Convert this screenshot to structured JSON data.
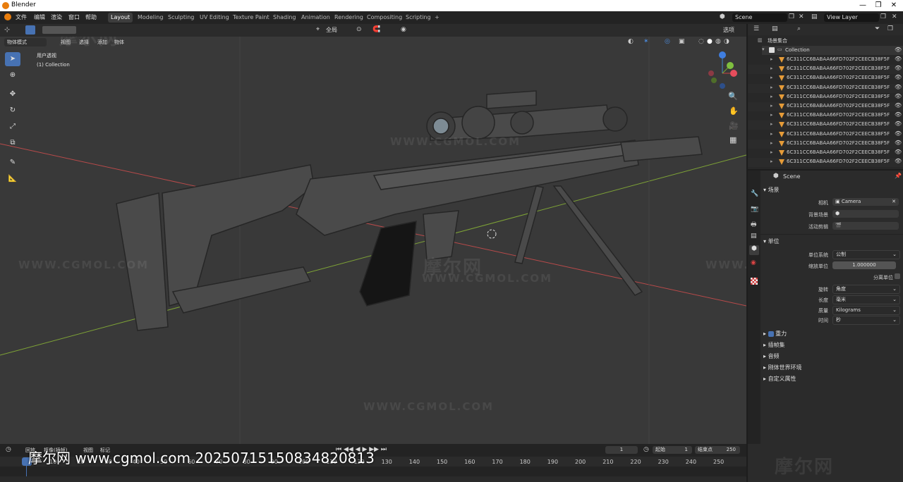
{
  "window": {
    "title": "Blender",
    "controls": [
      "—",
      "❐",
      "✕"
    ]
  },
  "menubar": {
    "items": [
      "文件",
      "编辑",
      "渲染",
      "窗口",
      "帮助"
    ]
  },
  "workspaces": {
    "tabs": [
      "Layout",
      "Modeling",
      "Sculpting",
      "UV Editing",
      "Texture Paint",
      "Shading",
      "Animation",
      "Rendering",
      "Compositing",
      "Scripting"
    ],
    "active": "Layout",
    "add": "+"
  },
  "scene": {
    "name": "Scene",
    "view_layer": "View Layer"
  },
  "viewport": {
    "mode": "物体模式",
    "menus": [
      "视图",
      "选择",
      "添加",
      "物体"
    ],
    "view_label": "用户透视",
    "collection_label": "(1) Collection",
    "transform_orientation": "全局",
    "options_label": "选项",
    "watermarks": [
      "WWW.CGMOL.COM",
      "WWW.CGMOL.COM",
      "WWW.CGMOL.COM",
      "WWW.CGMOL.COM",
      "WWW.CGMOL.COM"
    ],
    "logo_watermarks": [
      "摩尔网",
      "摩尔网"
    ]
  },
  "outliner": {
    "root": "场景集合",
    "collection": "Collection",
    "items": [
      "6C311CC6BABAA66FD702F2CEECB38F5F",
      "6C311CC6BABAA66FD702F2CEECB38F5F",
      "6C311CC6BABAA66FD702F2CEECB38F5F",
      "6C311CC6BABAA66FD702F2CEECB38F5F",
      "6C311CC6BABAA66FD702F2CEECB38F5F",
      "6C311CC6BABAA66FD702F2CEECB38F5F",
      "6C311CC6BABAA66FD702F2CEECB38F5F",
      "6C311CC6BABAA66FD702F2CEECB38F5F",
      "6C311CC6BABAA66FD702F2CEECB38F5F",
      "6C311CC6BABAA66FD702F2CEECB38F5F",
      "6C311CC6BABAA66FD702F2CEECB38F5F",
      "6C311CC6BABAA66FD702F2CEECB38F5F"
    ]
  },
  "properties": {
    "context": "Scene",
    "scene_section": "场景",
    "camera_label": "相机",
    "camera_value": "Camera",
    "background_label": "背景场景",
    "clip_label": "活动剪辑",
    "units_section": "单位",
    "unit_system_label": "单位系统",
    "unit_system_value": "公制",
    "unit_scale_label": "缩放单位",
    "unit_scale_value": "1.000000",
    "separate_units_label": "分离单位",
    "rotation_label": "旋转",
    "rotation_value": "角度",
    "length_label": "长度",
    "length_value": "毫米",
    "mass_label": "质量",
    "mass_value": "Kilograms",
    "time_label": "时间",
    "time_value": "秒",
    "collapsed_sections": [
      "重力",
      "插帧集",
      "音频",
      "刚体世界环境",
      "自定义属性"
    ]
  },
  "timeline": {
    "current_frame": "1",
    "start_label": "起始",
    "start_value": "1",
    "end_label": "结束点",
    "end_value": "250",
    "menus": [
      "回放",
      "抠像(插帧)",
      "视图",
      "标记"
    ],
    "ticks": [
      "0",
      "10",
      "20",
      "30",
      "40",
      "50",
      "60",
      "70",
      "80",
      "90",
      "100",
      "110",
      "120",
      "130",
      "140",
      "150",
      "160",
      "170",
      "180",
      "190",
      "200",
      "210",
      "220",
      "230",
      "240",
      "250"
    ]
  },
  "caption": "摩尔网 www.cgmol.com 20250715150834820813",
  "colors": {
    "accent": "#4772b3",
    "orange": "#e87d0d",
    "x_axis": "#b84a4a",
    "y_axis": "#7ea336"
  }
}
